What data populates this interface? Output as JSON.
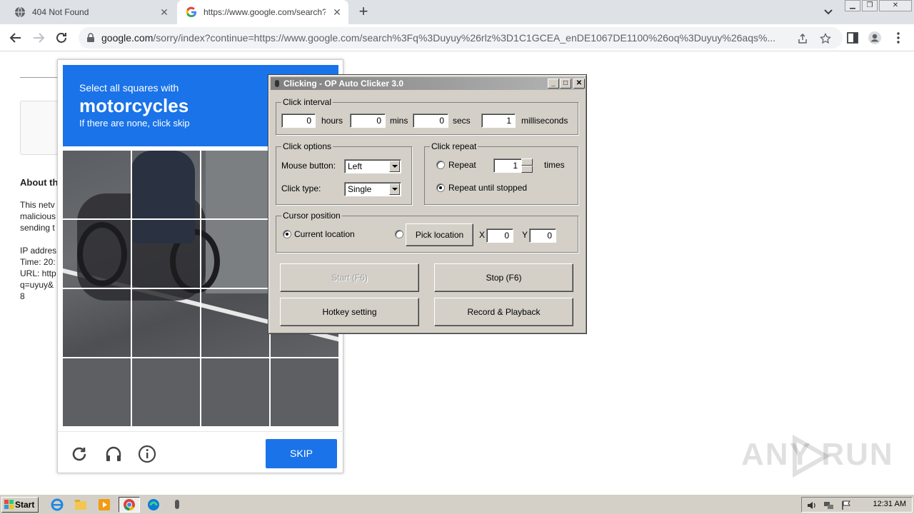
{
  "browser": {
    "tabs": [
      {
        "title": "404 Not Found",
        "favicon": "globe-icon"
      },
      {
        "title": "https://www.google.com/search?q=",
        "favicon": "google-icon"
      }
    ],
    "url_host": "google.com",
    "url_rest": "/sorry/index?continue=https://www.google.com/search%3Fq%3Duyuy%26rlz%3D1C1GCEA_enDE1067DE1100%26oq%3Duyuy%26aqs%..."
  },
  "page": {
    "about_heading": "About th",
    "text_lines": [
      "This netv",
      "malicious",
      "sending t",
      "",
      "IP addres",
      "Time: 20:",
      "URL: http",
      "q=uyuy&",
      "8"
    ]
  },
  "captcha": {
    "select_text": "Select all squares with",
    "object": "motorcycles",
    "none_text": "If there are none, click skip",
    "skip_label": "SKIP"
  },
  "clicker": {
    "title": "Clicking - OP Auto Clicker 3.0",
    "interval": {
      "label": "Click interval",
      "hours": "0",
      "hours_label": "hours",
      "mins": "0",
      "mins_label": "mins",
      "secs": "0",
      "secs_label": "secs",
      "ms": "1",
      "ms_label": "milliseconds"
    },
    "options": {
      "label": "Click options",
      "mouse_label": "Mouse button:",
      "mouse_value": "Left",
      "type_label": "Click type:",
      "type_value": "Single"
    },
    "repeat": {
      "label": "Click repeat",
      "repeat_label": "Repeat",
      "repeat_count": "1",
      "times_label": "times",
      "until_label": "Repeat until stopped"
    },
    "cursor": {
      "label": "Cursor position",
      "current_label": "Current location",
      "pick_label": "Pick location",
      "x_label": "X",
      "x_value": "0",
      "y_label": "Y",
      "y_value": "0"
    },
    "buttons": {
      "start": "Start (F6)",
      "stop": "Stop (F6)",
      "hotkey": "Hotkey setting",
      "record": "Record & Playback"
    }
  },
  "watermark": "ANY RUN",
  "taskbar": {
    "start_label": "Start",
    "clock": "12:31 AM"
  }
}
